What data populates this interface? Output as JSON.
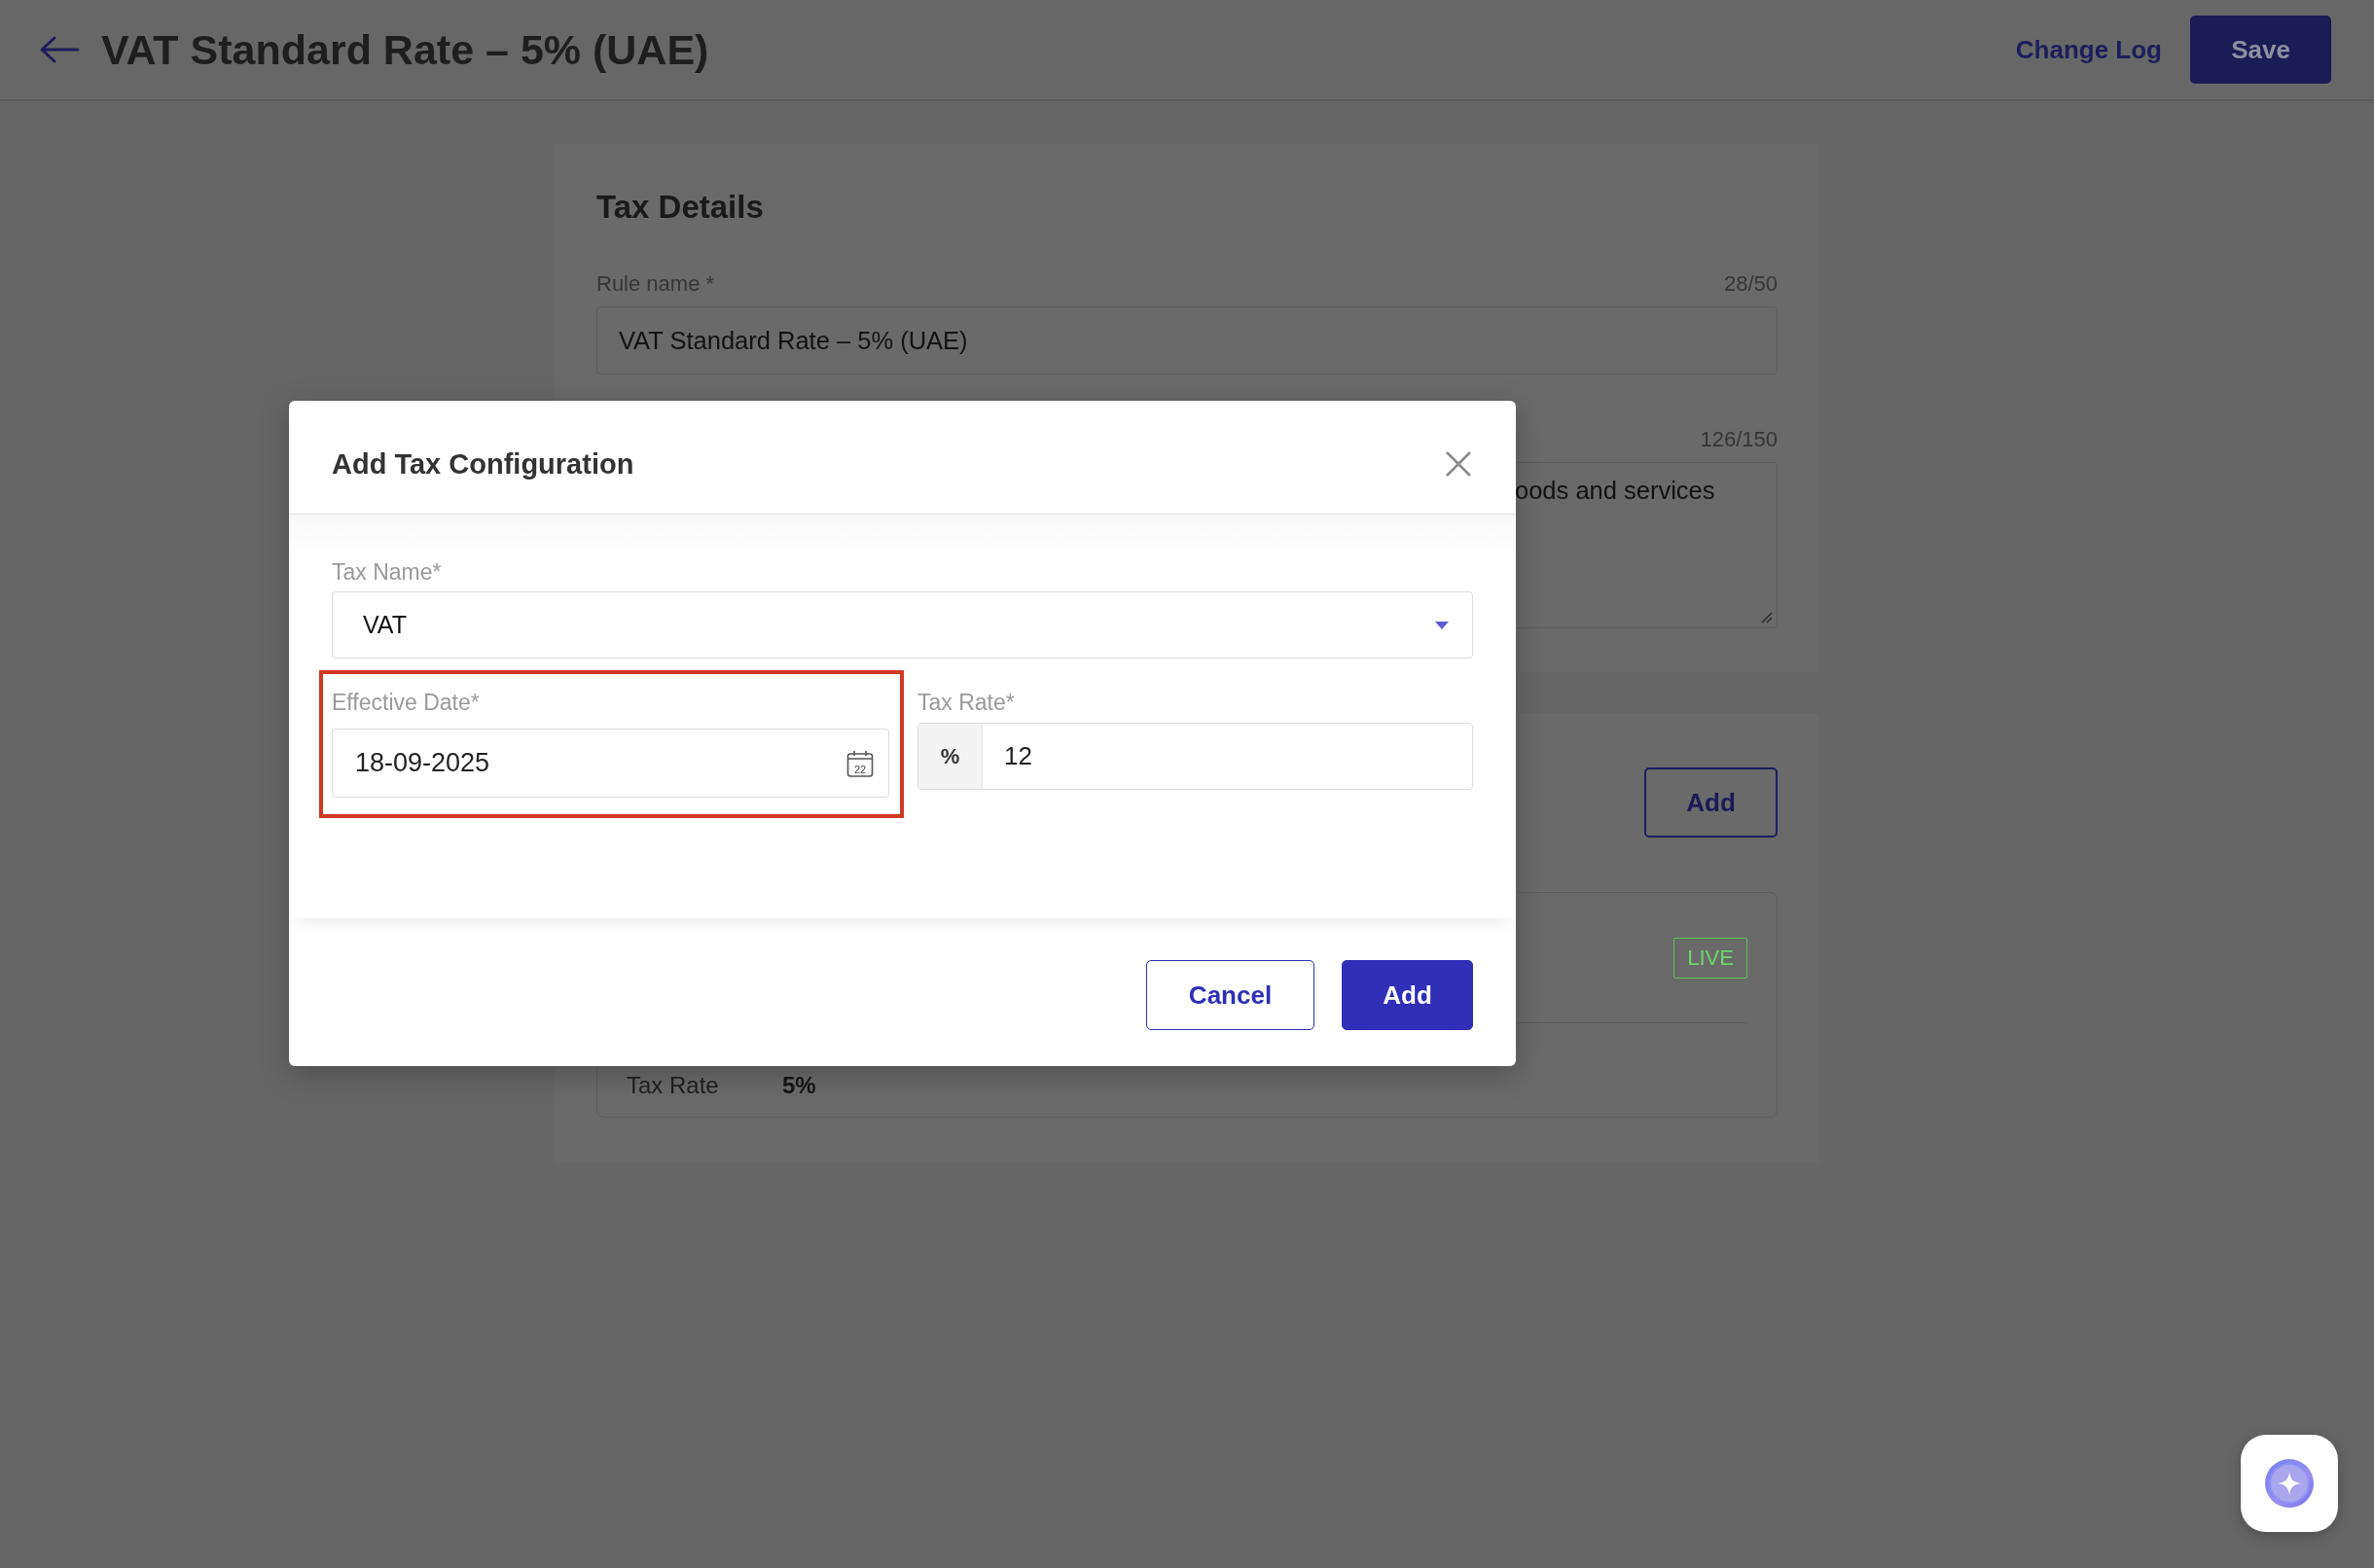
{
  "header": {
    "title": "VAT Standard Rate – 5% (UAE)",
    "actions": [
      {
        "label": "Change Log",
        "kind": "link"
      },
      {
        "label": "Save",
        "kind": "primary"
      }
    ]
  },
  "tax_details": {
    "title": "Tax Details",
    "fields": [
      {
        "kind": "input",
        "label": "Rule name *",
        "counter": "28/50",
        "value": "VAT Standard Rate – 5% (UAE)"
      },
      {
        "kind": "textarea",
        "counter": "126/150",
        "value": "oods and services"
      }
    ]
  },
  "tax_configurations": {
    "add_button": "Add",
    "entries": [
      {
        "status": "LIVE",
        "rows": [
          {
            "label": "Tax Rate",
            "value": "5%"
          }
        ]
      }
    ]
  },
  "dialog": {
    "title": "Add Tax Configuration",
    "tax_name": {
      "label": "Tax Name*",
      "value": "VAT"
    },
    "effective_date": {
      "label": "Effective Date*",
      "value": "18-09-2025",
      "calendar_day": "22",
      "highlighted": true
    },
    "tax_rate": {
      "label": "Tax Rate*",
      "prefix": "%",
      "value": "12"
    },
    "buttons": [
      {
        "label": "Cancel",
        "kind": "secondary"
      },
      {
        "label": "Add",
        "kind": "primary"
      }
    ]
  }
}
